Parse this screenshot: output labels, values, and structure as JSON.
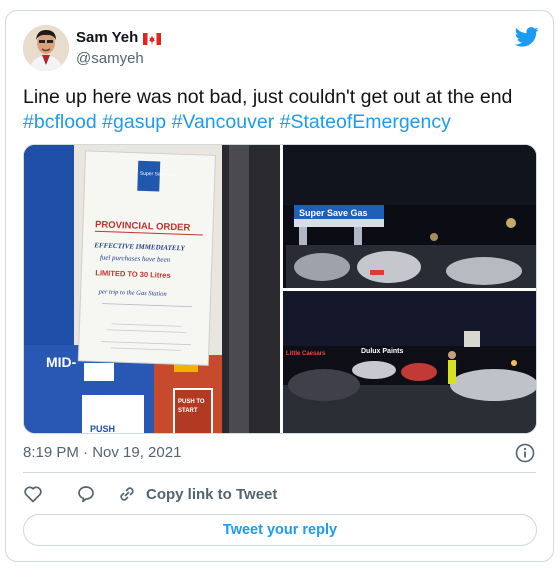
{
  "author": {
    "name": "Sam Yeh",
    "handle": "@samyeh",
    "flag_icon": "canada-flag-icon"
  },
  "tweet": {
    "text": "Line up here was not bad, just couldn't get out at the end",
    "hashtags": [
      "#bcflood",
      "#gasup",
      "#Vancouver",
      "#StateofEmergency"
    ]
  },
  "media": {
    "sign": {
      "brand": "Super Save Gas",
      "heading": "PROVINCIAL ORDER",
      "line1": "EFFECTIVE IMMEDIATELY",
      "line2": "fuel purchases have been",
      "line3": "LIMITED TO 30 Litres",
      "line4": "per trip to the Gas Station",
      "pump_label": "MID-",
      "push_label": "PUSH TO START",
      "push_bottom": "PUSH"
    },
    "station_sign": "Super Save Gas",
    "store_signs": [
      "Little Caesars",
      "Dulux Paints"
    ]
  },
  "meta": {
    "timestamp": "8:19 PM · Nov 19, 2021"
  },
  "actions": {
    "copy_link": "Copy link to Tweet"
  },
  "reply": {
    "label": "Tweet your reply"
  },
  "colors": {
    "accent": "#1d9bf0",
    "text": "#0f1419",
    "muted": "#536471",
    "border": "#cfd9de"
  }
}
